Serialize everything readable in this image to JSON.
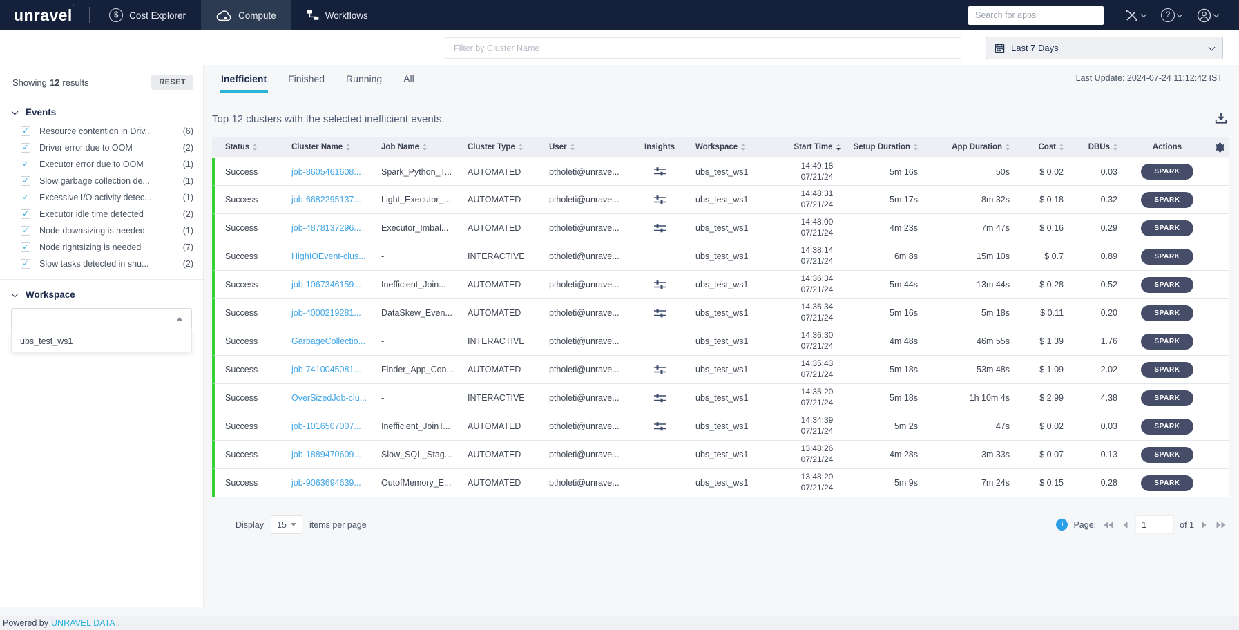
{
  "nav": {
    "logo": "unravel",
    "items": [
      {
        "label": "Cost Explorer",
        "icon": "dollar-circle",
        "active": false
      },
      {
        "label": "Compute",
        "icon": "cloud-gear",
        "active": true
      },
      {
        "label": "Workflows",
        "icon": "workflow",
        "active": false
      }
    ],
    "search_placeholder": "Search for apps"
  },
  "icons": {
    "dollar": "$",
    "help": "?",
    "info": "i",
    "check": "✓"
  },
  "filter_bar": {
    "cluster_filter_placeholder": "Filter by Cluster Name",
    "date_range": "Last 7 Days"
  },
  "sidebar": {
    "showing_prefix": "Showing",
    "result_count": "12",
    "showing_suffix": "results",
    "reset_label": "RESET",
    "events_title": "Events",
    "events": [
      {
        "label": "Resource contention in Driv...",
        "count": "(6)"
      },
      {
        "label": "Driver error due to OOM",
        "count": "(2)"
      },
      {
        "label": "Executor error due to OOM",
        "count": "(1)"
      },
      {
        "label": "Slow garbage collection de...",
        "count": "(1)"
      },
      {
        "label": "Excessive I/O activity detec...",
        "count": "(1)"
      },
      {
        "label": "Executor idle time detected",
        "count": "(2)"
      },
      {
        "label": "Node downsizing is needed",
        "count": "(1)"
      },
      {
        "label": "Node rightsizing is needed",
        "count": "(7)"
      },
      {
        "label": "Slow tasks detected in shu...",
        "count": "(2)"
      }
    ],
    "workspace_title": "Workspace",
    "workspace_options": [
      "ubs_test_ws1"
    ]
  },
  "main": {
    "tabs": [
      {
        "label": "Inefficient",
        "active": true
      },
      {
        "label": "Finished",
        "active": false
      },
      {
        "label": "Running",
        "active": false
      },
      {
        "label": "All",
        "active": false
      }
    ],
    "last_update": "Last Update: 2024-07-24 11:12:42 IST",
    "title": "Top 12 clusters with the selected inefficient events.",
    "table": {
      "columns": [
        {
          "label": "Status",
          "sortable": true,
          "sort_active": false
        },
        {
          "label": "Cluster Name",
          "sortable": true,
          "sort_active": false
        },
        {
          "label": "Job Name",
          "sortable": true,
          "sort_active": false
        },
        {
          "label": "Cluster Type",
          "sortable": true,
          "sort_active": false
        },
        {
          "label": "User",
          "sortable": true,
          "sort_active": false
        },
        {
          "label": "Insights",
          "sortable": false,
          "sort_active": false
        },
        {
          "label": "Workspace",
          "sortable": true,
          "sort_active": false
        },
        {
          "label": "Start Time",
          "sortable": true,
          "sort_active": true
        },
        {
          "label": "Setup Duration",
          "sortable": true,
          "sort_active": false
        },
        {
          "label": "App Duration",
          "sortable": true,
          "sort_active": false
        },
        {
          "label": "Cost",
          "sortable": true,
          "sort_active": false
        },
        {
          "label": "DBUs",
          "sortable": true,
          "sort_active": false
        },
        {
          "label": "Actions",
          "sortable": false,
          "sort_active": false
        }
      ],
      "rows": [
        {
          "status": "Success",
          "cluster_name": "job-8605461608...",
          "job_name": "Spark_Python_T...",
          "cluster_type": "AUTOMATED",
          "user": "ptholeti@unrave...",
          "insights": true,
          "workspace": "ubs_test_ws1",
          "start_time": "14:49:18",
          "start_date": "07/21/24",
          "setup_duration": "5m 16s",
          "app_duration": "50s",
          "cost": "$ 0.02",
          "dbus": "0.03",
          "action": "SPARK"
        },
        {
          "status": "Success",
          "cluster_name": "job-6682295137...",
          "job_name": "Light_Executor_...",
          "cluster_type": "AUTOMATED",
          "user": "ptholeti@unrave...",
          "insights": true,
          "workspace": "ubs_test_ws1",
          "start_time": "14:48:31",
          "start_date": "07/21/24",
          "setup_duration": "5m 17s",
          "app_duration": "8m 32s",
          "cost": "$ 0.18",
          "dbus": "0.32",
          "action": "SPARK"
        },
        {
          "status": "Success",
          "cluster_name": "job-4878137296...",
          "job_name": "Executor_Imbal...",
          "cluster_type": "AUTOMATED",
          "user": "ptholeti@unrave...",
          "insights": true,
          "workspace": "ubs_test_ws1",
          "start_time": "14:48:00",
          "start_date": "07/21/24",
          "setup_duration": "4m 23s",
          "app_duration": "7m 47s",
          "cost": "$ 0.16",
          "dbus": "0.29",
          "action": "SPARK"
        },
        {
          "status": "Success",
          "cluster_name": "HighIOEvent-clus...",
          "job_name": "-",
          "cluster_type": "INTERACTIVE",
          "user": "ptholeti@unrave...",
          "insights": false,
          "workspace": "ubs_test_ws1",
          "start_time": "14:38:14",
          "start_date": "07/21/24",
          "setup_duration": "6m 8s",
          "app_duration": "15m 10s",
          "cost": "$ 0.7",
          "dbus": "0.89",
          "action": "SPARK"
        },
        {
          "status": "Success",
          "cluster_name": "job-1067346159...",
          "job_name": "Inefficient_Join...",
          "cluster_type": "AUTOMATED",
          "user": "ptholeti@unrave...",
          "insights": true,
          "workspace": "ubs_test_ws1",
          "start_time": "14:36:34",
          "start_date": "07/21/24",
          "setup_duration": "5m 44s",
          "app_duration": "13m 44s",
          "cost": "$ 0.28",
          "dbus": "0.52",
          "action": "SPARK"
        },
        {
          "status": "Success",
          "cluster_name": "job-4000219281...",
          "job_name": "DataSkew_Even...",
          "cluster_type": "AUTOMATED",
          "user": "ptholeti@unrave...",
          "insights": true,
          "workspace": "ubs_test_ws1",
          "start_time": "14:36:34",
          "start_date": "07/21/24",
          "setup_duration": "5m 16s",
          "app_duration": "5m 18s",
          "cost": "$ 0.11",
          "dbus": "0.20",
          "action": "SPARK"
        },
        {
          "status": "Success",
          "cluster_name": "GarbageCollectio...",
          "job_name": "-",
          "cluster_type": "INTERACTIVE",
          "user": "ptholeti@unrave...",
          "insights": false,
          "workspace": "ubs_test_ws1",
          "start_time": "14:36:30",
          "start_date": "07/21/24",
          "setup_duration": "4m 48s",
          "app_duration": "46m 55s",
          "cost": "$ 1.39",
          "dbus": "1.76",
          "action": "SPARK"
        },
        {
          "status": "Success",
          "cluster_name": "job-7410045081...",
          "job_name": "Finder_App_Con...",
          "cluster_type": "AUTOMATED",
          "user": "ptholeti@unrave...",
          "insights": true,
          "workspace": "ubs_test_ws1",
          "start_time": "14:35:43",
          "start_date": "07/21/24",
          "setup_duration": "5m 18s",
          "app_duration": "53m 48s",
          "cost": "$ 1.09",
          "dbus": "2.02",
          "action": "SPARK"
        },
        {
          "status": "Success",
          "cluster_name": "OverSizedJob-clu...",
          "job_name": "-",
          "cluster_type": "INTERACTIVE",
          "user": "ptholeti@unrave...",
          "insights": true,
          "workspace": "ubs_test_ws1",
          "start_time": "14:35:20",
          "start_date": "07/21/24",
          "setup_duration": "5m 18s",
          "app_duration": "1h 10m 4s",
          "cost": "$ 2.99",
          "dbus": "4.38",
          "action": "SPARK"
        },
        {
          "status": "Success",
          "cluster_name": "job-1016507007...",
          "job_name": "Inefficient_JoinT...",
          "cluster_type": "AUTOMATED",
          "user": "ptholeti@unrave...",
          "insights": true,
          "workspace": "ubs_test_ws1",
          "start_time": "14:34:39",
          "start_date": "07/21/24",
          "setup_duration": "5m 2s",
          "app_duration": "47s",
          "cost": "$ 0.02",
          "dbus": "0.03",
          "action": "SPARK"
        },
        {
          "status": "Success",
          "cluster_name": "job-1889470609...",
          "job_name": "Slow_SQL_Stag...",
          "cluster_type": "AUTOMATED",
          "user": "ptholeti@unrave...",
          "insights": false,
          "workspace": "ubs_test_ws1",
          "start_time": "13:48:26",
          "start_date": "07/21/24",
          "setup_duration": "4m 28s",
          "app_duration": "3m 33s",
          "cost": "$ 0.07",
          "dbus": "0.13",
          "action": "SPARK"
        },
        {
          "status": "Success",
          "cluster_name": "job-9063694639...",
          "job_name": "OutofMemory_E...",
          "cluster_type": "AUTOMATED",
          "user": "ptholeti@unrave...",
          "insights": false,
          "workspace": "ubs_test_ws1",
          "start_time": "13:48:20",
          "start_date": "07/21/24",
          "setup_duration": "5m 9s",
          "app_duration": "7m 24s",
          "cost": "$ 0.15",
          "dbus": "0.28",
          "action": "SPARK"
        }
      ]
    },
    "pagination": {
      "display_label": "Display",
      "page_size": "15",
      "items_label": "items per page",
      "page_label": "Page:",
      "current_page": "1",
      "of_label": "of 1"
    }
  },
  "footer": {
    "powered_by": "Powered by",
    "brand": "UNRAVEL DATA",
    "suffix": "."
  },
  "colors": {
    "nav_background": "#15203A",
    "accent_cyan": "#2CB5DB",
    "link_blue": "#42A6E8",
    "success_green": "#35D235",
    "spark_badge": "#454D68"
  }
}
